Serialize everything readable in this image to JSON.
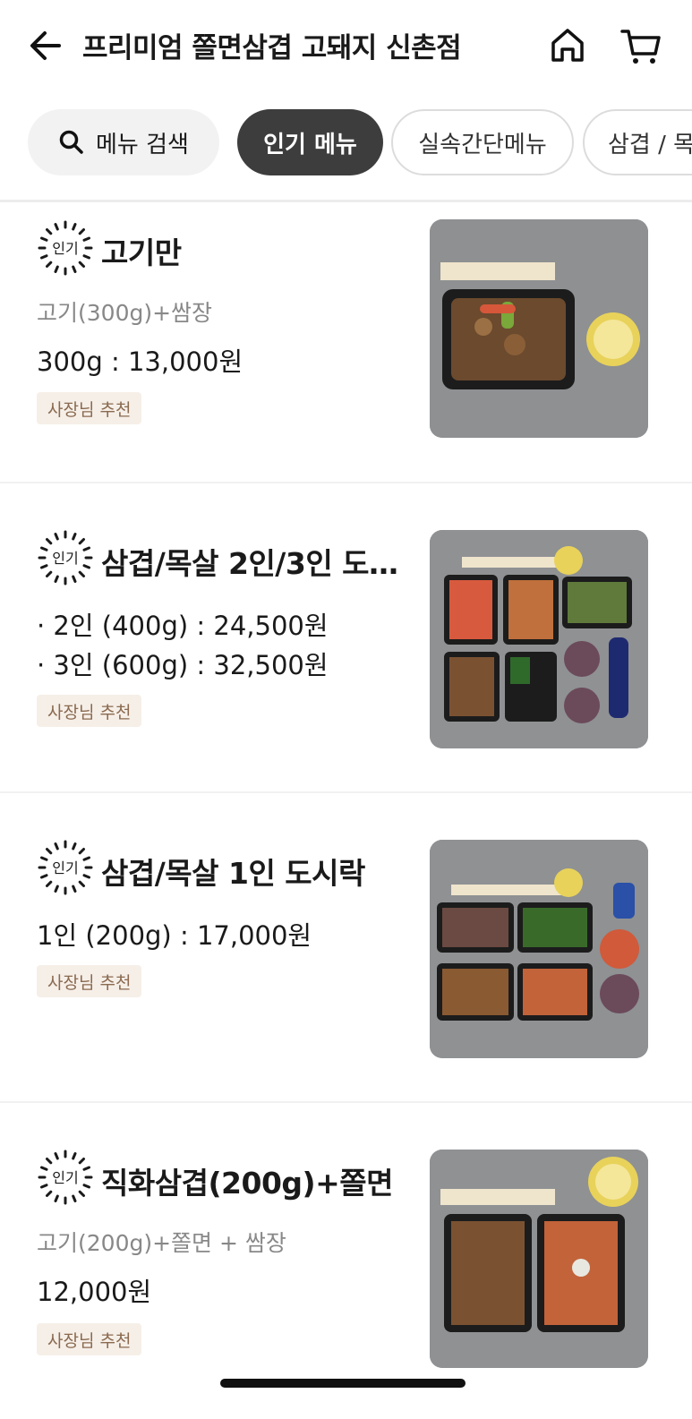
{
  "header": {
    "title": "프리미엄 쫄면삼겹 고돼지 신촌점",
    "back_icon": "back-arrow-icon",
    "home_icon": "home-icon",
    "cart_icon": "cart-icon"
  },
  "tabs": {
    "search_label": "메뉴 검색",
    "items": [
      {
        "label": "인기 메뉴",
        "active": true
      },
      {
        "label": "실속간단메뉴",
        "active": false
      },
      {
        "label": "삼겹 / 목",
        "active": false
      }
    ]
  },
  "badge_text": "인기",
  "menu_items": [
    {
      "name": "고기만",
      "desc": "고기(300g)+쌈장",
      "prices": [
        "300g : 13,000원"
      ],
      "tag": "사장님 추천"
    },
    {
      "name": "삼겹/목살 2인/3인 도…",
      "desc": "",
      "prices": [
        "· 2인 (400g) : 24,500원",
        "· 3인 (600g) : 32,500원"
      ],
      "tag": "사장님 추천"
    },
    {
      "name": "삼겹/목살 1인 도시락",
      "desc": "",
      "prices": [
        "1인 (200g) : 17,000원"
      ],
      "tag": "사장님 추천"
    },
    {
      "name": "직화삼겹(200g)+쫄면",
      "desc": "고기(200g)+쫄면 + 쌈장",
      "prices": [
        "12,000원"
      ],
      "tag": "사장님 추천"
    }
  ],
  "colors": {
    "active_tab_bg": "#3d3d3d",
    "tag_bg": "#f6efe8",
    "tag_text": "#8a6a50",
    "desc_text": "#888888"
  }
}
